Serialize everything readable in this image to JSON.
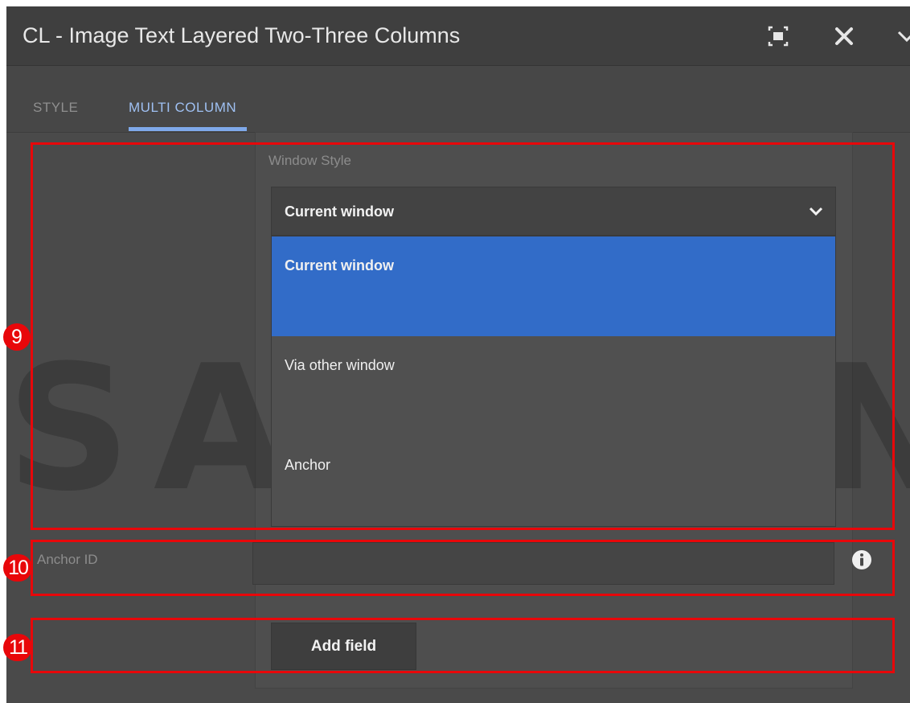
{
  "dialog": {
    "title": "CL - Image Text Layered Two-Three Columns",
    "icons": [
      "fullscreen-icon",
      "close-icon",
      "chevron-down-icon"
    ]
  },
  "tabs": [
    {
      "label": "STYLE",
      "active": false
    },
    {
      "label": "MULTI COLUMN",
      "active": true
    }
  ],
  "window_style": {
    "label": "Window Style",
    "selected": "Current window",
    "options": [
      "Current window",
      "Via other window",
      "Anchor"
    ]
  },
  "anchor_id": {
    "label": "Anchor ID",
    "value": ""
  },
  "add_field": {
    "label": "Add field"
  },
  "watermark": {
    "text": "SAMSUNG"
  },
  "annotations": [
    {
      "number": "9"
    },
    {
      "number": "10"
    },
    {
      "number": "11"
    }
  ],
  "colors": {
    "accent": "#326cc8",
    "tab_active": "#9fc0f2",
    "annotation": "#e8070a",
    "background": "#4a4a4a"
  }
}
